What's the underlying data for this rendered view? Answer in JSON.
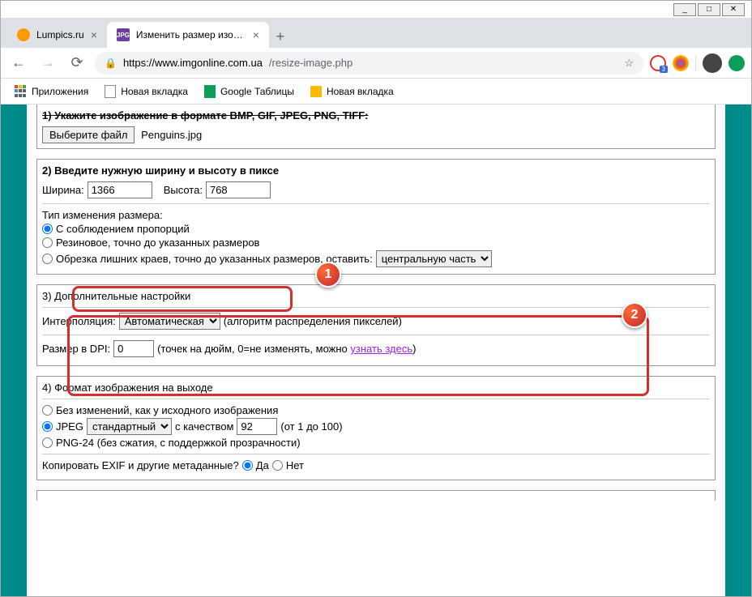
{
  "window_controls": {
    "min": "_",
    "max": "□",
    "close": "✕"
  },
  "tabs": [
    {
      "title": "Lumpics.ru",
      "active": false
    },
    {
      "title": "Изменить размер изображения",
      "active": true,
      "favicon_text": "JPG"
    }
  ],
  "addrbar": {
    "url_host": "https://www.imgonline.com.ua",
    "url_path": "/resize-image.php",
    "ext_badge": "3"
  },
  "bookmarks": [
    {
      "label": "Приложения"
    },
    {
      "label": "Новая вкладка"
    },
    {
      "label": "Google Таблицы"
    },
    {
      "label": "Новая вкладка"
    }
  ],
  "section1": {
    "title": "1) Укажите изображение в формате BMP, GIF, JPEG, PNG, TIFF:",
    "file_btn": "Выберите файл",
    "file_name": "Penguins.jpg"
  },
  "section2": {
    "title": "2) Введите нужную ширину и высоту в пиксе",
    "width_label": "Ширина:",
    "width_value": "1366",
    "height_label": "Высота:",
    "height_value": "768",
    "resize_type_label": "Тип изменения размера:",
    "opt_proportional": "С соблюдением пропорций",
    "opt_rubber": "Резиновое, точно до указанных размеров",
    "opt_crop": "Обрезка лишних краев, точно до указанных размеров, оставить:",
    "crop_select": "центральную часть"
  },
  "section3": {
    "title": "3) Дополнительные настройки",
    "interp_label": "Интерполяция:",
    "interp_value": "Автоматическая",
    "interp_hint": "(алгоритм распределения пикселей)",
    "dpi_label": "Размер в DPI:",
    "dpi_value": "0",
    "dpi_hint_pre": "(точек на дюйм, 0=не изменять, можно ",
    "dpi_link": "узнать здесь",
    "dpi_hint_post": ")"
  },
  "section4": {
    "title": "4) Формат изображения на выходе",
    "opt_unchanged": "Без изменений, как у исходного изображения",
    "opt_jpeg": "JPEG",
    "jpeg_preset": "стандартный",
    "jpeg_quality_label": "с качеством",
    "jpeg_quality_value": "92",
    "jpeg_quality_hint": "(от 1 до 100)",
    "opt_png": "PNG-24 (без сжатия, с поддержкой прозрачности)",
    "exif_label": "Копировать EXIF и другие метаданные?",
    "exif_yes": "Да",
    "exif_no": "Нет"
  },
  "badges": {
    "b1": "1",
    "b2": "2"
  }
}
